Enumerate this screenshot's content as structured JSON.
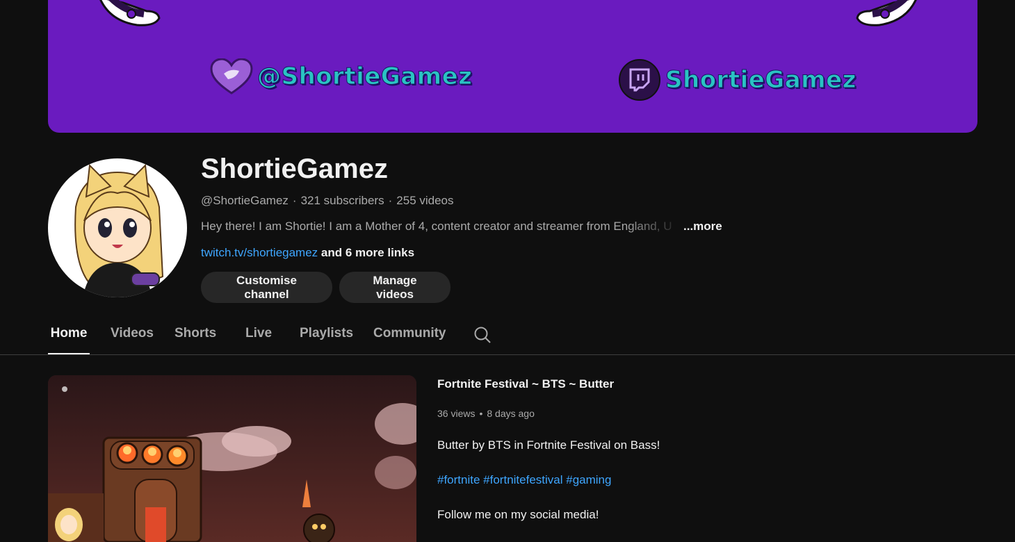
{
  "banner": {
    "twitter_handle": "@ShortieGamez",
    "twitch_handle": "ShortieGamez",
    "twitter_icon": "heart-bird-icon",
    "twitch_icon": "twitch-icon",
    "background_color": "#6a1bbf"
  },
  "channel": {
    "name": "ShortieGamez",
    "handle": "@ShortieGamez",
    "subscribers": "321 subscribers",
    "videos": "255 videos",
    "separator": "·",
    "description": "Hey there! I am Shortie! I am a Mother of 4, content creator and streamer from England, U",
    "more_label": "...more",
    "primary_link": "twitch.tv/shortiegamez",
    "more_links": "and 6 more links",
    "avatar_icon": "cartoon-avatar"
  },
  "actions": {
    "customise_label": "Customise channel",
    "manage_label": "Manage videos"
  },
  "tabs": [
    {
      "label": "Home",
      "active": true
    },
    {
      "label": "Videos",
      "active": false
    },
    {
      "label": "Shorts",
      "active": false
    },
    {
      "label": "Live",
      "active": false
    },
    {
      "label": "Playlists",
      "active": false
    },
    {
      "label": "Community",
      "active": false
    }
  ],
  "tab_search_icon": "search-icon",
  "featured_video": {
    "title": "Fortnite Festival ~ BTS ~ Butter",
    "views": "36 views",
    "age": "8 days ago",
    "separator": "•",
    "description_line1": "Butter by BTS in Fortnite Festival on Bass!",
    "hashtags": [
      "#fortnite",
      "#fortnitefestival",
      "#gaming"
    ],
    "description_line3": "Follow me on my social media!"
  },
  "colors": {
    "background": "#0f0f0f",
    "link": "#3ea6ff",
    "text_primary": "#f1f1f1",
    "text_secondary": "#aaaaaa",
    "button_bg": "#272727"
  }
}
